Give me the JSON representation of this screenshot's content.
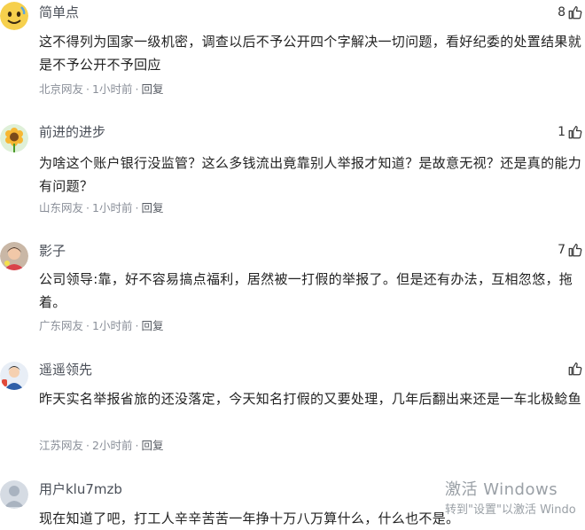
{
  "comments": [
    {
      "username": "简单点",
      "likes": "8",
      "text": "这不得列为国家一级机密，调查以后不予公开四个字解决一切问题，看好纪委的处置结果就是不予公开不予回应",
      "location": "北京网友",
      "time": "1小时前",
      "reply": "回复",
      "avatar": "emoji-face-avatar"
    },
    {
      "username": "前进的进步",
      "likes": "1",
      "text": "为啥这个账户银行没监管？这么多钱流出竟靠别人举报才知道？是故意无视？还是真的能力有问题？",
      "location": "山东网友",
      "time": "1小时前",
      "reply": "回复",
      "avatar": "sunflower-avatar"
    },
    {
      "username": "影子",
      "likes": "7",
      "text": "公司领导:靠，好不容易搞点福利，居然被一打假的举报了。但是还有办法，互相忽悠，拖着。",
      "location": "广东网友",
      "time": "1小时前",
      "reply": "回复",
      "avatar": "child-photo-avatar"
    },
    {
      "username": "遥遥领先",
      "likes": "",
      "text": "昨天实名举报省旅的还没落定，今天知名打假的又要处理，几年后翻出来还是一车北极鲶鱼",
      "location": "江苏网友",
      "time": "2小时前",
      "reply": "回复",
      "avatar": "cartoon-avatar"
    },
    {
      "username": "用户klu7mzb",
      "likes": "",
      "text": "现在知道了吧，打工人辛辛苦苦一年挣十万八万算什么，什么也不是。",
      "location": "",
      "time": "",
      "reply": "",
      "avatar": "default-user-avatar"
    }
  ],
  "watermark": {
    "line1": "激活 Windows",
    "line2": "转到\"设置\"以激活 Windo"
  }
}
